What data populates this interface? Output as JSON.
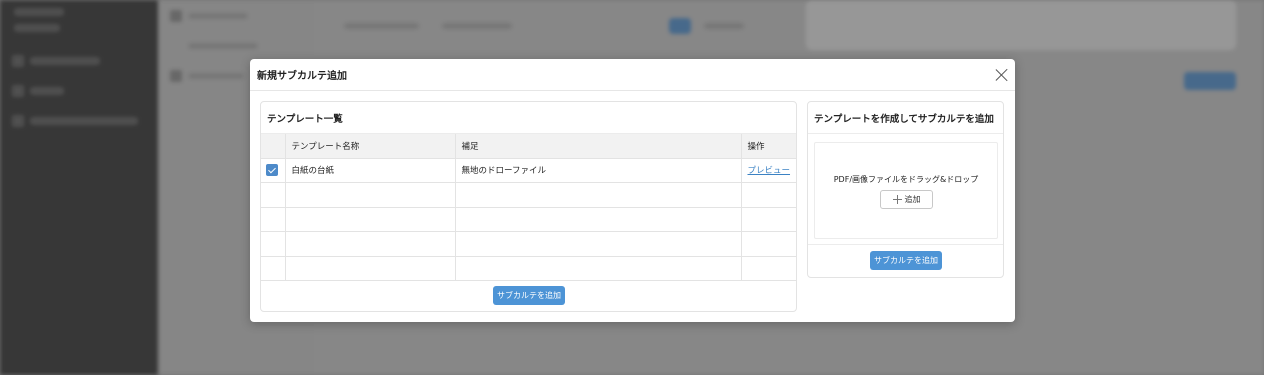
{
  "modal": {
    "title": "新規サブカルテ追加"
  },
  "template_list": {
    "title": "テンプレート一覧",
    "columns": [
      "テンプレート名称",
      "補足",
      "操作"
    ],
    "rows": [
      {
        "checked": true,
        "name": "白紙の台紙",
        "note": "無地のドローファイル",
        "action": "プレビュー"
      }
    ],
    "add_button": "サブカルテを追加"
  },
  "create_panel": {
    "title": "テンプレートを作成してサブカルテを追加",
    "drop_text": "PDF/画像ファイルをドラッグ&ドロップ",
    "add_small": "追加",
    "add_button": "サブカルテを追加"
  },
  "colors": {
    "primary": "#4d94d6",
    "checkbox": "#4d8ac9",
    "link": "#3b82c4"
  }
}
